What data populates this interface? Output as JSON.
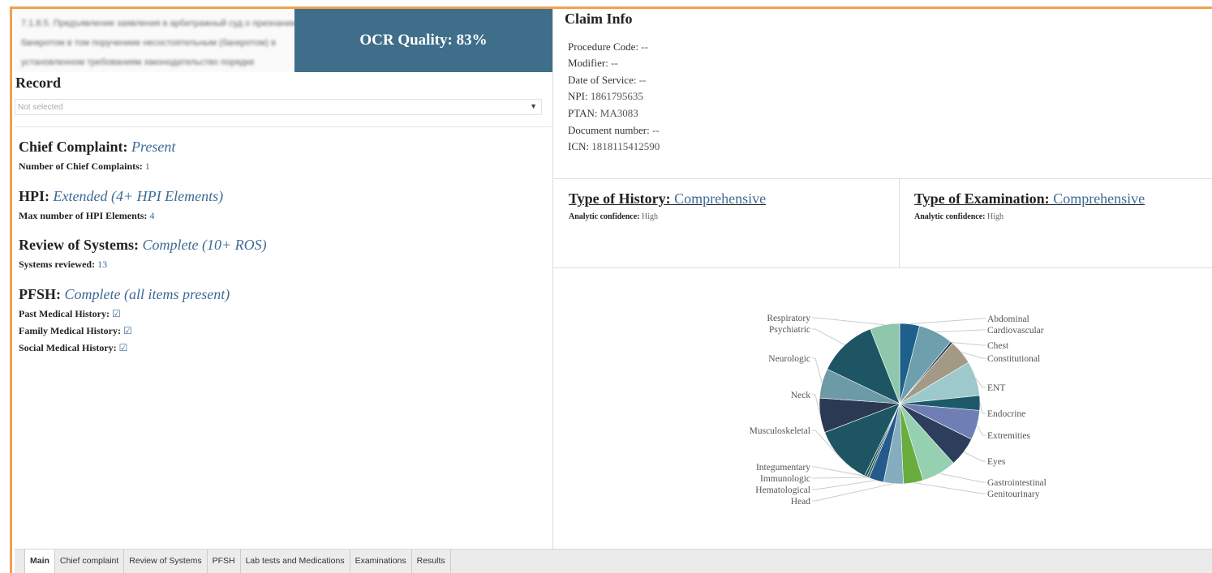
{
  "header": {
    "thumbnail_lines": [
      "7.1.8.5. Предъявление заявления в арбитражный суд о признании",
      "банкротом в том порученииe несостоятельным (банкротом) в",
      "установленном требованиям законодательство порядке"
    ],
    "ocr_label": "OCR Quality: 83%"
  },
  "record": {
    "title": "Record",
    "select_value": "Not selected"
  },
  "sections": {
    "chief_complaint": {
      "title": "Chief Complaint:",
      "value": "Present",
      "sub_label": "Number of Chief Complaints:",
      "sub_value": "1"
    },
    "hpi": {
      "title": "HPI:",
      "value": "Extended (4+ HPI Elements)",
      "sub_label": "Max number of HPI Elements:",
      "sub_value": "4"
    },
    "ros": {
      "title": "Review of Systems:",
      "value": "Complete (10+ ROS)",
      "sub_label": "Systems reviewed:",
      "sub_value": "13"
    },
    "pfsh": {
      "title": "PFSH:",
      "value": "Complete (all items present)",
      "items": [
        {
          "label": "Past Medical History:",
          "mark": "☑"
        },
        {
          "label": "Family Medical History:",
          "mark": "☑"
        },
        {
          "label": "Social Medical History:",
          "mark": "☑"
        }
      ]
    }
  },
  "claim": {
    "title": "Claim Info",
    "rows": [
      {
        "label": "Procedure Code:",
        "value": "--"
      },
      {
        "label": "Modifier:",
        "value": "--"
      },
      {
        "label": "Date of Service:",
        "value": "--"
      },
      {
        "label": "NPI:",
        "value": "1861795635"
      },
      {
        "label": "PTAN:",
        "value": "MA3083"
      },
      {
        "label": "Document number:",
        "value": "--"
      },
      {
        "label": "ICN:",
        "value": "1818115412590"
      }
    ]
  },
  "history": {
    "title": "Type of History:",
    "value": "Comprehensive",
    "conf_label": "Analytic confidence:",
    "conf_value": "High"
  },
  "examination": {
    "title": "Type of Examination:",
    "value": "Comprehensive",
    "conf_label": "Analytic confidence:",
    "conf_value": "High"
  },
  "chart_data": {
    "type": "pie",
    "slices": [
      {
        "label": "Abdominal",
        "value": 4,
        "color": "#1f5f8b",
        "side": "right"
      },
      {
        "label": "Cardiovascular",
        "value": 7,
        "color": "#6e9fad",
        "side": "right"
      },
      {
        "label": "Chest",
        "value": 0.5,
        "color": "#2a3d55",
        "side": "right"
      },
      {
        "label": "Constitutional",
        "value": 5,
        "color": "#a39a86",
        "side": "right"
      },
      {
        "label": "ENT",
        "value": 7,
        "color": "#9dc8cc",
        "side": "right"
      },
      {
        "label": "Endocrine",
        "value": 3,
        "color": "#1c5a6a",
        "side": "right"
      },
      {
        "label": "Extremities",
        "value": 6,
        "color": "#6f7fb6",
        "side": "right"
      },
      {
        "label": "Eyes",
        "value": 6,
        "color": "#2c3e5c",
        "side": "right"
      },
      {
        "label": "Gastrointestinal",
        "value": 7,
        "color": "#95d0b0",
        "side": "right"
      },
      {
        "label": "Genitourinary",
        "value": 4,
        "color": "#6aac3e",
        "side": "right"
      },
      {
        "label": "Head",
        "value": 4,
        "color": "#84aec0",
        "side": "left"
      },
      {
        "label": "Hematological",
        "value": 3,
        "color": "#255a8c",
        "side": "left"
      },
      {
        "label": "Immunologic",
        "value": 0.5,
        "color": "#3a6e5a",
        "side": "left"
      },
      {
        "label": "Integumentary",
        "value": 0.5,
        "color": "#1e4f60",
        "side": "left"
      },
      {
        "label": "Musculoskeletal",
        "value": 12,
        "color": "#1d5563",
        "side": "left"
      },
      {
        "label": "Neck",
        "value": 7,
        "color": "#2b3a52",
        "side": "left"
      },
      {
        "label": "Neurologic",
        "value": 6,
        "color": "#6c9aa6",
        "side": "left"
      },
      {
        "label": "Psychiatric",
        "value": 12,
        "color": "#1e5564",
        "side": "left"
      },
      {
        "label": "Respiratory",
        "value": 6,
        "color": "#8ec7ab",
        "side": "left"
      }
    ]
  },
  "tabs": [
    {
      "label": "Main",
      "active": true
    },
    {
      "label": "Chief complaint",
      "active": false
    },
    {
      "label": "Review of Systems",
      "active": false
    },
    {
      "label": "PFSH",
      "active": false
    },
    {
      "label": "Lab tests and Medications",
      "active": false
    },
    {
      "label": "Examinations",
      "active": false
    },
    {
      "label": "Results",
      "active": false
    }
  ]
}
